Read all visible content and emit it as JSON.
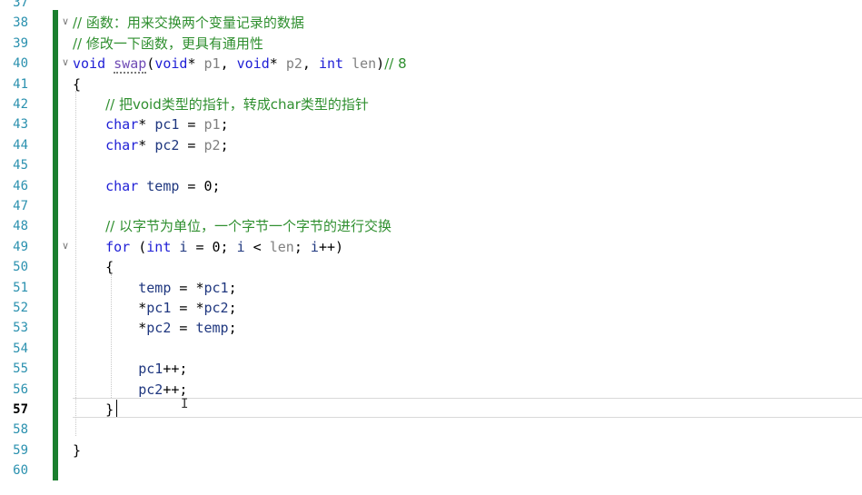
{
  "editor": {
    "current_line": 57,
    "lines": [
      {
        "num": "37",
        "parts": []
      },
      {
        "num": "38",
        "fold": true,
        "parts": [
          {
            "t": "cm",
            "v": "// 函数：用来交换两个变量记录的数据"
          }
        ]
      },
      {
        "num": "39",
        "parts": [
          {
            "t": "cm",
            "v": "// 修改一下函数，更具有通用性"
          }
        ]
      },
      {
        "num": "40",
        "fold": true,
        "parts": [
          {
            "t": "kw",
            "v": "void"
          },
          {
            "t": "",
            "v": " "
          },
          {
            "t": "fn",
            "v": "swap"
          },
          {
            "t": "",
            "v": "("
          },
          {
            "t": "kw",
            "v": "void"
          },
          {
            "t": "",
            "v": "* "
          },
          {
            "t": "pm",
            "v": "p1"
          },
          {
            "t": "",
            "v": ", "
          },
          {
            "t": "kw",
            "v": "void"
          },
          {
            "t": "",
            "v": "* "
          },
          {
            "t": "pm",
            "v": "p2"
          },
          {
            "t": "",
            "v": ", "
          },
          {
            "t": "kw",
            "v": "int"
          },
          {
            "t": "",
            "v": " "
          },
          {
            "t": "pm",
            "v": "len"
          },
          {
            "t": "",
            "v": ")"
          },
          {
            "t": "cm",
            "v": "// 8"
          }
        ]
      },
      {
        "num": "41",
        "parts": [
          {
            "t": "",
            "v": "{"
          }
        ]
      },
      {
        "num": "42",
        "parts": [
          {
            "t": "",
            "v": "    "
          },
          {
            "t": "cm",
            "v": "// 把void类型的指针，转成char类型的指针"
          }
        ]
      },
      {
        "num": "43",
        "parts": [
          {
            "t": "",
            "v": "    "
          },
          {
            "t": "kw",
            "v": "char"
          },
          {
            "t": "",
            "v": "* "
          },
          {
            "t": "vr",
            "v": "pc1"
          },
          {
            "t": "",
            "v": " = "
          },
          {
            "t": "pm",
            "v": "p1"
          },
          {
            "t": "",
            "v": ";"
          }
        ]
      },
      {
        "num": "44",
        "parts": [
          {
            "t": "",
            "v": "    "
          },
          {
            "t": "kw",
            "v": "char"
          },
          {
            "t": "",
            "v": "* "
          },
          {
            "t": "vr",
            "v": "pc2"
          },
          {
            "t": "",
            "v": " = "
          },
          {
            "t": "pm",
            "v": "p2"
          },
          {
            "t": "",
            "v": ";"
          }
        ]
      },
      {
        "num": "45",
        "parts": []
      },
      {
        "num": "46",
        "parts": [
          {
            "t": "",
            "v": "    "
          },
          {
            "t": "kw",
            "v": "char"
          },
          {
            "t": "",
            "v": " "
          },
          {
            "t": "vr",
            "v": "temp"
          },
          {
            "t": "",
            "v": " = "
          },
          {
            "t": "",
            "v": "0"
          },
          {
            "t": "",
            "v": ";"
          }
        ]
      },
      {
        "num": "47",
        "parts": []
      },
      {
        "num": "48",
        "parts": [
          {
            "t": "",
            "v": "    "
          },
          {
            "t": "cm",
            "v": "// 以字节为单位，一个字节一个字节的进行交换"
          }
        ]
      },
      {
        "num": "49",
        "fold": true,
        "parts": [
          {
            "t": "",
            "v": "    "
          },
          {
            "t": "kw",
            "v": "for"
          },
          {
            "t": "",
            "v": " ("
          },
          {
            "t": "kw",
            "v": "int"
          },
          {
            "t": "",
            "v": " "
          },
          {
            "t": "vr",
            "v": "i"
          },
          {
            "t": "",
            "v": " = 0; "
          },
          {
            "t": "vr",
            "v": "i"
          },
          {
            "t": "",
            "v": " < "
          },
          {
            "t": "pm",
            "v": "len"
          },
          {
            "t": "",
            "v": "; "
          },
          {
            "t": "vr",
            "v": "i"
          },
          {
            "t": "",
            "v": "++)"
          }
        ]
      },
      {
        "num": "50",
        "parts": [
          {
            "t": "",
            "v": "    {"
          }
        ]
      },
      {
        "num": "51",
        "parts": [
          {
            "t": "",
            "v": "        "
          },
          {
            "t": "vr",
            "v": "temp"
          },
          {
            "t": "",
            "v": " = *"
          },
          {
            "t": "vr",
            "v": "pc1"
          },
          {
            "t": "",
            "v": ";"
          }
        ]
      },
      {
        "num": "52",
        "parts": [
          {
            "t": "",
            "v": "        *"
          },
          {
            "t": "vr",
            "v": "pc1"
          },
          {
            "t": "",
            "v": " = *"
          },
          {
            "t": "vr",
            "v": "pc2"
          },
          {
            "t": "",
            "v": ";"
          }
        ]
      },
      {
        "num": "53",
        "parts": [
          {
            "t": "",
            "v": "        *"
          },
          {
            "t": "vr",
            "v": "pc2"
          },
          {
            "t": "",
            "v": " = "
          },
          {
            "t": "vr",
            "v": "temp"
          },
          {
            "t": "",
            "v": ";"
          }
        ]
      },
      {
        "num": "54",
        "parts": []
      },
      {
        "num": "55",
        "parts": [
          {
            "t": "",
            "v": "        "
          },
          {
            "t": "vr",
            "v": "pc1"
          },
          {
            "t": "",
            "v": "++;"
          }
        ]
      },
      {
        "num": "56",
        "parts": [
          {
            "t": "",
            "v": "        "
          },
          {
            "t": "vr",
            "v": "pc2"
          },
          {
            "t": "",
            "v": "++;"
          }
        ]
      },
      {
        "num": "57",
        "parts": [
          {
            "t": "",
            "v": "    }"
          }
        ]
      },
      {
        "num": "58",
        "parts": []
      },
      {
        "num": "59",
        "parts": [
          {
            "t": "",
            "v": "}"
          }
        ]
      },
      {
        "num": "60",
        "parts": []
      }
    ]
  },
  "colors": {
    "change_bar": "#1a7f2e",
    "keyword": "#1f1fd6",
    "comment": "#2f8f2f",
    "function": "#6f4bb5",
    "parameter": "#808080",
    "line_number": "#2b91af"
  }
}
